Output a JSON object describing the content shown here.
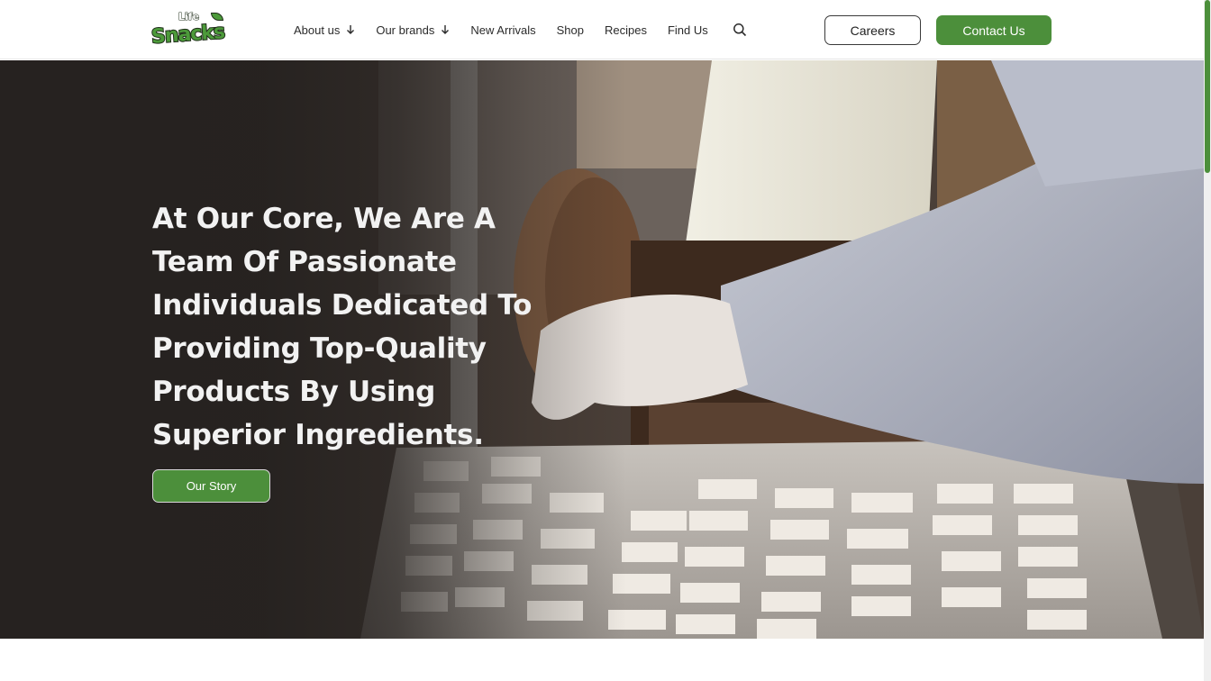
{
  "brand": {
    "logo_top": "Life",
    "logo_word": "Snacks",
    "green": "#4c8f3b"
  },
  "nav": {
    "items": [
      {
        "label": "About us",
        "has_dropdown": true
      },
      {
        "label": "Our brands",
        "has_dropdown": true
      },
      {
        "label": "New Arrivals",
        "has_dropdown": false
      },
      {
        "label": "Shop",
        "has_dropdown": false
      },
      {
        "label": "Recipes",
        "has_dropdown": false
      },
      {
        "label": "Find Us",
        "has_dropdown": false
      }
    ],
    "search_icon": "search-icon",
    "dropdown_icon": "arrow-down-icon"
  },
  "header_actions": {
    "careers_label": "Careers",
    "contact_label": "Contact Us"
  },
  "hero": {
    "title": "At Our Core, We Are A Team Of Passionate Individuals Dedicated To Providing Top-Quality Products By Using Superior Ingredients.",
    "cta_label": "Our Story",
    "background": "factory-production-line-photo"
  }
}
